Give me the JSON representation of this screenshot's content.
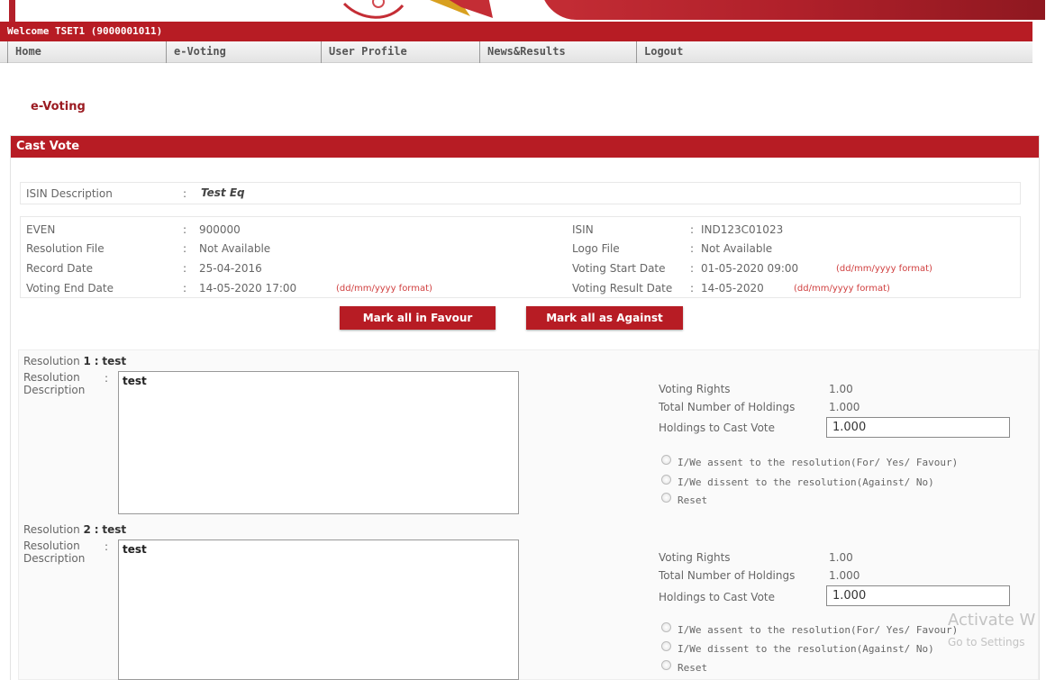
{
  "header": {
    "welcome_text": "Welcome TSET1 (9000001011)"
  },
  "nav": {
    "items": [
      "Home",
      "e-Voting",
      "User Profile",
      "News&Results",
      "Logout"
    ]
  },
  "page": {
    "title": "e-Voting",
    "panel_title": "Cast Vote"
  },
  "isin_description": {
    "label": "ISIN Description",
    "value": "Test Eq"
  },
  "details": {
    "even": {
      "label": "EVEN",
      "value": "900000"
    },
    "resolution_file": {
      "label": "Resolution File",
      "value": "Not Available"
    },
    "record_date": {
      "label": "Record Date",
      "value": "25-04-2016"
    },
    "voting_end_date": {
      "label": "Voting End Date",
      "value": "14-05-2020  17:00",
      "format": "(dd/mm/yyyy format)"
    },
    "isin": {
      "label": "ISIN",
      "value": "IND123C01023"
    },
    "logo_file": {
      "label": "Logo File",
      "value": "Not Available"
    },
    "voting_start_date": {
      "label": "Voting Start Date",
      "value": "01-05-2020  09:00",
      "format": "(dd/mm/yyyy format)"
    },
    "voting_result_date": {
      "label": "Voting Result Date",
      "value": "14-05-2020",
      "format": "(dd/mm/yyyy format)"
    }
  },
  "buttons": {
    "mark_favour": "Mark all in Favour",
    "mark_against": "Mark all as Against"
  },
  "labels": {
    "resolution_prefix": "Resolution",
    "resolution_description": "Resolution Description",
    "voting_rights": "Voting Rights",
    "total_holdings": "Total Number of Holdings",
    "holdings_to_cast": "Holdings to Cast Vote",
    "assent": "I/We assent to the resolution(For/ Yes/ Favour)",
    "dissent": "I/We dissent to the resolution(Against/ No)",
    "reset": "Reset"
  },
  "resolutions": [
    {
      "number": "1",
      "name": "test",
      "description": "test",
      "voting_rights": "1.00",
      "total_holdings": "1.000",
      "holdings_to_cast": "1.000"
    },
    {
      "number": "2",
      "name": "test",
      "description": "test",
      "voting_rights": "1.00",
      "total_holdings": "1.000",
      "holdings_to_cast": "1.000"
    }
  ],
  "watermark": {
    "line1": "Activate W",
    "line2": "Go to Settings"
  },
  "colors": {
    "brand_red": "#b71c24",
    "format_hint": "#d04040"
  }
}
